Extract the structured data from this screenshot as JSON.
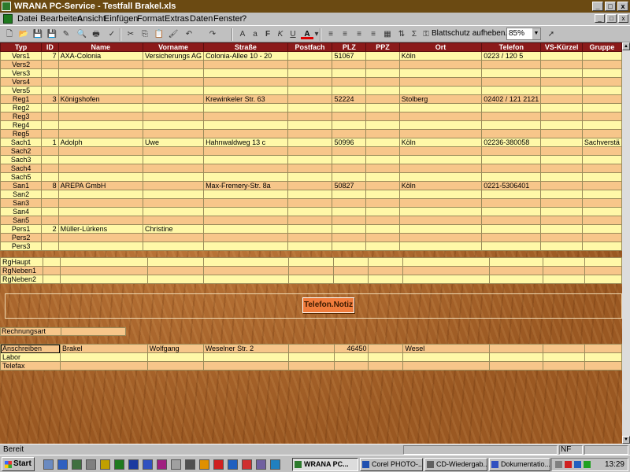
{
  "window": {
    "title": "WRANA PC-Service - Testfall Brakel.xls",
    "buttons": [
      "_",
      "□",
      "x"
    ],
    "mdi_buttons": [
      "_",
      "□",
      "x"
    ]
  },
  "menu": [
    "Datei",
    "Bearbeiten",
    "Ansicht",
    "Einfügen",
    "Format",
    "Extras",
    "Daten",
    "Fenster",
    "?"
  ],
  "toolbar": {
    "protect_label": "Blattschutz aufheben...",
    "zoom": "85%",
    "font_buttons": [
      "F",
      "K",
      "U",
      "A"
    ]
  },
  "grid": {
    "headers": [
      "Typ",
      "ID",
      "Name",
      "Vorname",
      "Straße",
      "Postfach",
      "PLZ",
      "PPZ",
      "Ort",
      "Telefon",
      "VS-Kürzel",
      "Gruppe"
    ],
    "rows": [
      [
        "Vers1",
        "7",
        "AXA-Colonia",
        "Versicherungs AG",
        "Colonia-Allee 10 - 20",
        "",
        "51067",
        "",
        "Köln",
        "0223 / 120 5",
        "",
        ""
      ],
      [
        "Vers2",
        "",
        "",
        "",
        "",
        "",
        "",
        "",
        "",
        "",
        "",
        ""
      ],
      [
        "Vers3",
        "",
        "",
        "",
        "",
        "",
        "",
        "",
        "",
        "",
        "",
        ""
      ],
      [
        "Vers4",
        "",
        "",
        "",
        "",
        "",
        "",
        "",
        "",
        "",
        "",
        ""
      ],
      [
        "Vers5",
        "",
        "",
        "",
        "",
        "",
        "",
        "",
        "",
        "",
        "",
        ""
      ],
      [
        "Reg1",
        "3",
        "Königshofen",
        "",
        "Krewinkeler Str. 63",
        "",
        "52224",
        "",
        "Stolberg",
        "02402 / 121 2121",
        "",
        ""
      ],
      [
        "Reg2",
        "",
        "",
        "",
        "",
        "",
        "",
        "",
        "",
        "",
        "",
        ""
      ],
      [
        "Reg3",
        "",
        "",
        "",
        "",
        "",
        "",
        "",
        "",
        "",
        "",
        ""
      ],
      [
        "Reg4",
        "",
        "",
        "",
        "",
        "",
        "",
        "",
        "",
        "",
        "",
        ""
      ],
      [
        "Reg5",
        "",
        "",
        "",
        "",
        "",
        "",
        "",
        "",
        "",
        "",
        ""
      ],
      [
        "Sach1",
        "1",
        "Adolph",
        "Uwe",
        "Hahnwaldweg 13 c",
        "",
        "50996",
        "",
        "Köln",
        "02236-380058",
        "",
        "Sachverstä"
      ],
      [
        "Sach2",
        "",
        "",
        "",
        "",
        "",
        "",
        "",
        "",
        "",
        "",
        ""
      ],
      [
        "Sach3",
        "",
        "",
        "",
        "",
        "",
        "",
        "",
        "",
        "",
        "",
        ""
      ],
      [
        "Sach4",
        "",
        "",
        "",
        "",
        "",
        "",
        "",
        "",
        "",
        "",
        ""
      ],
      [
        "Sach5",
        "",
        "",
        "",
        "",
        "",
        "",
        "",
        "",
        "",
        "",
        ""
      ],
      [
        "San1",
        "8",
        "AREPA GmbH",
        "",
        "Max-Fremery-Str. 8a",
        "",
        "50827",
        "",
        "Köln",
        "0221-5306401",
        "",
        ""
      ],
      [
        "San2",
        "",
        "",
        "",
        "",
        "",
        "",
        "",
        "",
        "",
        "",
        ""
      ],
      [
        "San3",
        "",
        "",
        "",
        "",
        "",
        "",
        "",
        "",
        "",
        "",
        ""
      ],
      [
        "San4",
        "",
        "",
        "",
        "",
        "",
        "",
        "",
        "",
        "",
        "",
        ""
      ],
      [
        "San5",
        "",
        "",
        "",
        "",
        "",
        "",
        "",
        "",
        "",
        "",
        ""
      ],
      [
        "Pers1",
        "2",
        "Müller-Lürkens",
        "Christine",
        "",
        "",
        "",
        "",
        "",
        "",
        "",
        ""
      ],
      [
        "Pers2",
        "",
        "",
        "",
        "",
        "",
        "",
        "",
        "",
        "",
        "",
        ""
      ],
      [
        "Pers3",
        "",
        "",
        "",
        "",
        "",
        "",
        "",
        "",
        "",
        "",
        ""
      ]
    ]
  },
  "rg_rows": [
    "RgHaupt",
    "RgNeben1",
    "RgNeben2"
  ],
  "notiz_button": "Telefon.Notiz",
  "rechnungsart_label": "Rechnungsart",
  "address_rows": [
    [
      "Anschreiben",
      "Brakel",
      "Wolfgang",
      "Weselner Str. 2",
      "",
      "46450",
      "",
      "Wesel",
      "",
      "",
      ""
    ],
    [
      "Labor",
      "",
      "",
      "",
      "",
      "",
      "",
      "",
      "",
      "",
      ""
    ],
    [
      "Telefax",
      "",
      "",
      "",
      "",
      "",
      "",
      "",
      "",
      "",
      ""
    ]
  ],
  "status": {
    "text": "Bereit",
    "nf": "NF"
  },
  "taskbar": {
    "start": "Start",
    "tasks": [
      "WRANA PC...",
      "Corel PHOTO-...",
      "CD-Wiedergab...",
      "Dokumentatio..."
    ],
    "clock": "13:29"
  },
  "colors": {
    "header_bg": "#8b1a1a",
    "row_yellow": "#fff8a8",
    "row_orange": "#f7c68a",
    "wood": "#a0602a",
    "button_orange": "#f07c3c"
  }
}
